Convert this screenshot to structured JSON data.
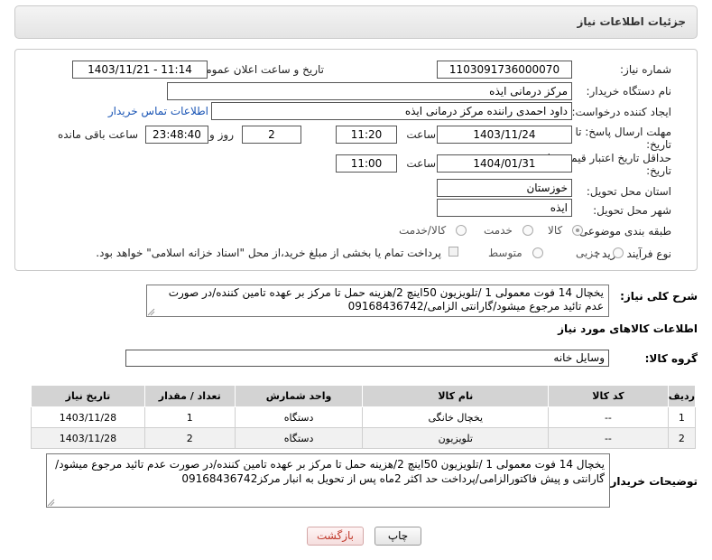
{
  "page_title": "جزئیات اطلاعات نیاز",
  "labels": {
    "need_number": "شماره نیاز:",
    "announce_datetime": "تاریخ و ساعت اعلان عمومی:",
    "buyer_org": "نام دستگاه خریدار:",
    "requester": "ایجاد کننده درخواست:",
    "reply_deadline_line1": "مهلت ارسال پاسخ: تا",
    "reply_deadline_line2": "تاریخ:",
    "min_validity_line1": "حداقل تاریخ اعتبار قیمت: تا",
    "min_validity_line2": "تاریخ:",
    "delivery_province": "استان محل تحویل:",
    "delivery_city": "شهر محل تحویل:",
    "category": "طبقه بندی موضوعی:",
    "purchase_type": "نوع فرآیند خرید :",
    "time": "ساعت",
    "days_and": "روز و",
    "remaining": "ساعت باقی مانده",
    "general_desc": "شرح کلی نیاز:",
    "goods_info": "اطلاعات کالاهای مورد نیاز",
    "goods_group": "گروه کالا:",
    "buyer_notes": "توضیحات خریدار:"
  },
  "fields": {
    "need_number": "1103091736000070",
    "announce_datetime": "1403/11/21 - 11:14",
    "buyer_org": "مرکز درمانی ایذه",
    "requester": "داود احمدی راننده مرکز درمانی ایذه",
    "contact_link": "اطلاعات تماس خریدار",
    "reply_date": "1403/11/24",
    "reply_time": "11:20",
    "reply_days": "2",
    "reply_remaining": "23:48:40",
    "validity_date": "1404/01/31",
    "validity_time": "11:00",
    "province": "خوزستان",
    "city": "ایذه",
    "general_desc": "یخچال 14 فوت معمولی 1 /تلویزیون 50اینچ 2/هزینه حمل تا مرکز بر عهده تامین کننده/در صورت عدم تائید مرجوع میشود/گارانتی الزامی/09168436742",
    "goods_group": "وسایل خانه",
    "buyer_notes": "یخچال 14 فوت معمولی 1 /تلویزیون 50اینچ 2/هزینه حمل تا مرکز بر عهده تامین کننده/در صورت عدم تائید مرجوع میشود/گارانتی و پیش فاکتورالزامی/پرداخت حد اکثر 2ماه پس از تحویل به انبار مرکز09168436742"
  },
  "category_options": [
    {
      "label": "کالا",
      "selected": true
    },
    {
      "label": "خدمت",
      "selected": false
    },
    {
      "label": "کالا/خدمت",
      "selected": false
    }
  ],
  "purchase_options": [
    {
      "label": "جزیی",
      "selected": false
    },
    {
      "label": "متوسط",
      "selected": false
    }
  ],
  "payment_note": "پرداخت تمام یا بخشی از مبلغ خرید،از محل \"اسناد خزانه اسلامی\" خواهد بود.",
  "table": {
    "headers": [
      "ردیف",
      "کد کالا",
      "نام کالا",
      "واحد شمارش",
      "تعداد / مقدار",
      "تاریخ نیاز"
    ],
    "rows": [
      [
        "1",
        "--",
        "یخچال خانگی",
        "دستگاه",
        "1",
        "1403/11/28"
      ],
      [
        "2",
        "--",
        "تلویزیون",
        "دستگاه",
        "2",
        "1403/11/28"
      ]
    ]
  },
  "buttons": {
    "print": "چاپ",
    "back": "بازگشت"
  },
  "colors": {
    "header_bg": "#d3d3d3",
    "link": "#1a55b5",
    "back_text": "#c0392b"
  }
}
